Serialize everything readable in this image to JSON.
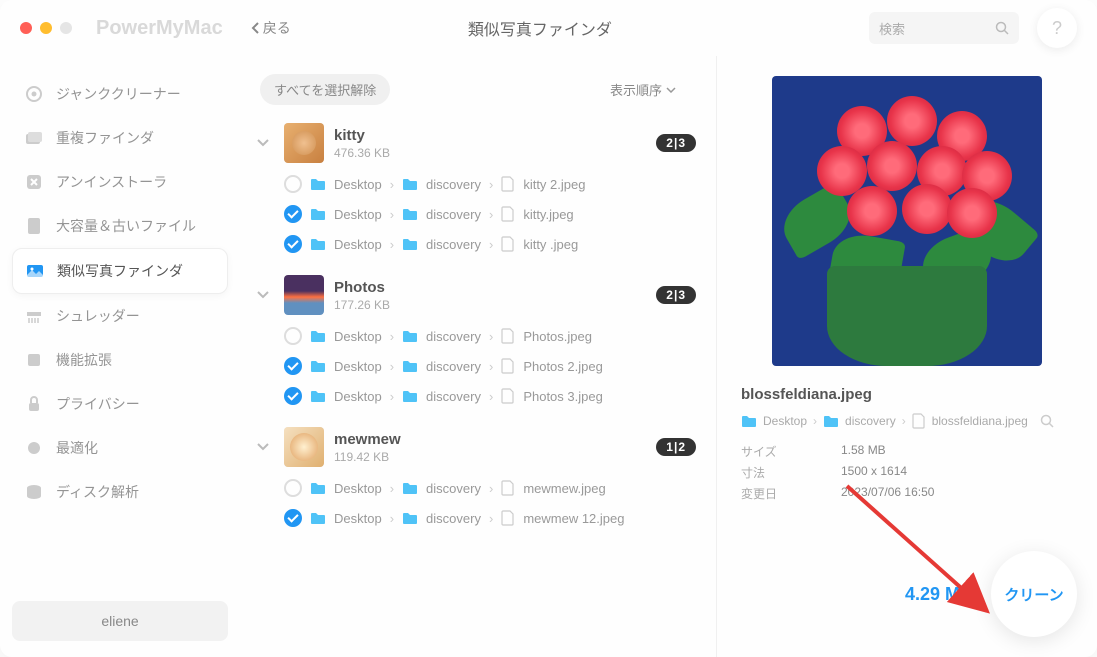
{
  "app_name": "PowerMyMac",
  "back_label": "戻る",
  "page_title": "類似写真ファインダ",
  "search_placeholder": "検索",
  "help_label": "?",
  "sidebar": {
    "items": [
      {
        "label": "ジャンククリーナー"
      },
      {
        "label": "重複ファインダ"
      },
      {
        "label": "アンインストーラ"
      },
      {
        "label": "大容量＆古いファイル"
      },
      {
        "label": "類似写真ファインダ"
      },
      {
        "label": "シュレッダー"
      },
      {
        "label": "機能拡張"
      },
      {
        "label": "プライバシー"
      },
      {
        "label": "最適化"
      },
      {
        "label": "ディスク解析"
      }
    ],
    "user": "eliene"
  },
  "toolbar": {
    "deselect_label": "すべてを選択解除",
    "sort_label": "表示順序"
  },
  "groups": [
    {
      "name": "kitty",
      "size": "476.36 KB",
      "badge": "2|3",
      "files": [
        {
          "checked": false,
          "path1": "Desktop",
          "path2": "discovery",
          "file": "kitty 2.jpeg"
        },
        {
          "checked": true,
          "path1": "Desktop",
          "path2": "discovery",
          "file": "kitty.jpeg"
        },
        {
          "checked": true,
          "path1": "Desktop",
          "path2": "discovery",
          "file": "kitty .jpeg"
        }
      ]
    },
    {
      "name": "Photos",
      "size": "177.26 KB",
      "badge": "2|3",
      "files": [
        {
          "checked": false,
          "path1": "Desktop",
          "path2": "discovery",
          "file": "Photos.jpeg"
        },
        {
          "checked": true,
          "path1": "Desktop",
          "path2": "discovery",
          "file": "Photos 2.jpeg"
        },
        {
          "checked": true,
          "path1": "Desktop",
          "path2": "discovery",
          "file": "Photos 3.jpeg"
        }
      ]
    },
    {
      "name": "mewmew",
      "size": "119.42 KB",
      "badge": "1|2",
      "files": [
        {
          "checked": false,
          "path1": "Desktop",
          "path2": "discovery",
          "file": "mewmew.jpeg"
        },
        {
          "checked": true,
          "path1": "Desktop",
          "path2": "discovery",
          "file": "mewmew 12.jpeg"
        }
      ]
    }
  ],
  "preview": {
    "filename": "blossfeldiana.jpeg",
    "path1": "Desktop",
    "path2": "discovery",
    "path3": "blossfeldiana.jpeg",
    "meta": {
      "size_label": "サイズ",
      "size_value": "1.58 MB",
      "dim_label": "寸法",
      "dim_value": "1500 x 1614",
      "mod_label": "変更日",
      "mod_value": "2023/07/06 16:50"
    }
  },
  "footer": {
    "total_size": "4.29 MB",
    "clean_label": "クリーン"
  }
}
